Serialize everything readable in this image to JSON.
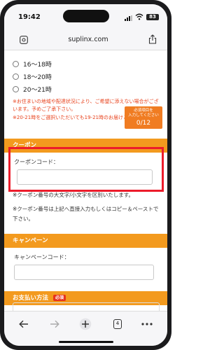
{
  "status_bar": {
    "time": "19:42",
    "battery": "83"
  },
  "browser": {
    "url": "suplinx.com",
    "tabs_count": "4"
  },
  "time_options": [
    {
      "label": "16～18時"
    },
    {
      "label": "18～20時"
    },
    {
      "label": "20～21時"
    }
  ],
  "delivery_notes": {
    "line1": "※お住まいの地域や配達状況により、ご希望に添えない場合がございます。予めご了承下さい。",
    "line2": "※20-21時をご選択いただいても19-21時のお届けとなります。"
  },
  "required_badge": {
    "title": "必須項目を\n入力してください",
    "count": "0/12"
  },
  "coupon": {
    "section_title": "クーポン",
    "field_label": "クーポンコード：",
    "value": "",
    "note1": "※クーポン番号の大文字/小文字を区別いたします。",
    "note2": "※クーポン番号は上記へ直接入力もしくはコピー＆ペーストで下さい。"
  },
  "campaign": {
    "section_title": "キャンペーン",
    "field_label": "キャンペーンコード：",
    "value": ""
  },
  "payment": {
    "section_title": "お支払い方法",
    "required_tag": "必須"
  },
  "colors": {
    "accent": "#f39a1e",
    "highlight": "#ec1c2b",
    "note": "#e8421c"
  }
}
